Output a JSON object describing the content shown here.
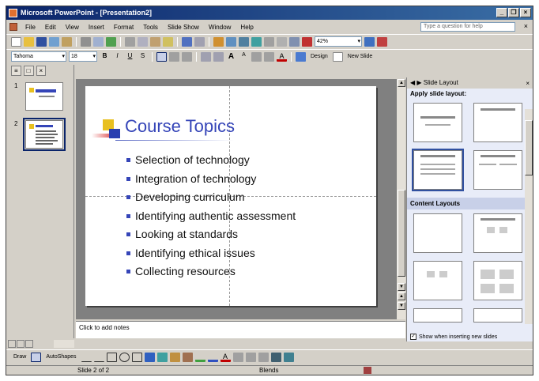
{
  "window": {
    "title": "Microsoft PowerPoint - [Presentation2]"
  },
  "menu": {
    "items": [
      "File",
      "Edit",
      "View",
      "Insert",
      "Format",
      "Tools",
      "Slide Show",
      "Window",
      "Help"
    ],
    "ask_placeholder": "Type a question for help"
  },
  "formatting": {
    "font": "Tahoma",
    "size": "18",
    "zoom": "42%",
    "design_label": "Design",
    "new_slide_label": "New Slide"
  },
  "outline": {
    "slide_numbers": [
      "1",
      "2"
    ]
  },
  "slide": {
    "title": "Course Topics",
    "bullets": [
      "Selection of technology",
      "Integration of technology",
      "Developing curriculum",
      "Identifying authentic assessment",
      "Looking at standards",
      "Identifying ethical issues",
      "Collecting resources"
    ]
  },
  "notes": {
    "placeholder": "Click to add notes"
  },
  "taskpane": {
    "title": "Slide Layout",
    "apply_label": "Apply slide layout:",
    "content_layouts_label": "Content Layouts",
    "show_when_inserting": "Show when inserting new slides"
  },
  "drawing": {
    "draw_label": "Draw",
    "autoshapes_label": "AutoShapes"
  },
  "status": {
    "slide_position": "Slide 2 of 2",
    "design_name": "Blends"
  }
}
